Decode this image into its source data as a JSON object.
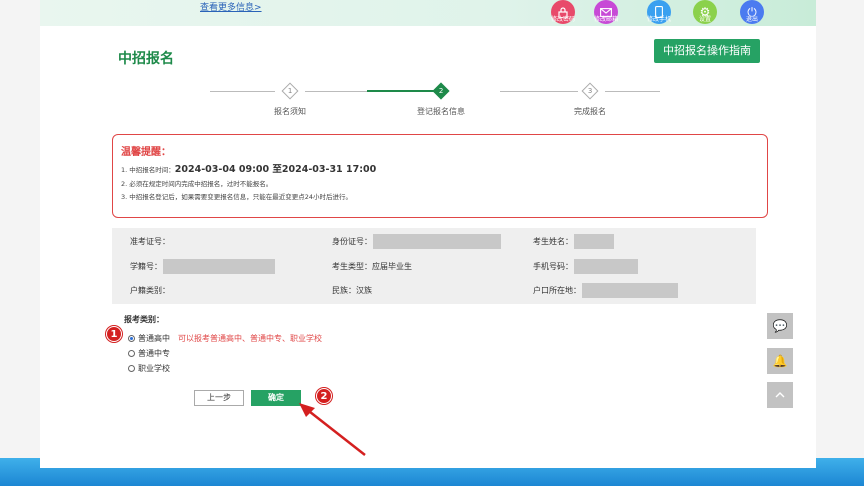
{
  "header": {
    "more_link": "查看更多信息>",
    "buttons": [
      {
        "label": "修改密码",
        "icon": "lock-icon",
        "color": "#e84a6a"
      },
      {
        "label": "修改邮箱",
        "icon": "mail-icon",
        "color": "#c74ad6"
      },
      {
        "label": "修改手机",
        "icon": "phone-icon",
        "color": "#3aa0f0"
      },
      {
        "label": "设置",
        "icon": "gear-icon",
        "color": "#8bd14c"
      },
      {
        "label": "退出",
        "icon": "power-icon",
        "color": "#4b7bf0"
      }
    ]
  },
  "page": {
    "title": "中招报名",
    "guide_button": "中招报名操作指南"
  },
  "steps": [
    {
      "num": "1",
      "label": "报名须知"
    },
    {
      "num": "2",
      "label": "登记报名信息"
    },
    {
      "num": "3",
      "label": "完成报名"
    }
  ],
  "notice": {
    "title": "温馨提醒：",
    "line1_prefix": "1. 中招报名时间：",
    "line1_time": "2024-03-04 09:00 至2024-03-31 17:00",
    "line2": "2. 必须在规定时间内完成中招报名，过时不能报名。",
    "line3": "3. 中招报名登记后，如果需要变更报名信息，只能在最近变更点24小时后进行。"
  },
  "info": {
    "exam_no": "准考证号：",
    "id_no": "身份证号：",
    "name": "考生姓名：",
    "student_no": "学籍号：",
    "type": "考生类型：应届毕业生",
    "phone": "手机号码：",
    "household": "户籍类别：",
    "ethnicity": "民族：汉族",
    "residence": "户口所在地："
  },
  "category": {
    "title": "报考类别：",
    "options": [
      "普通高中",
      "普通中专",
      "职业学校"
    ],
    "selected": "普通高中",
    "note": "可以报考普通高中、普通中专、职业学校"
  },
  "actions": {
    "prev": "上一步",
    "confirm": "确定"
  },
  "markers": [
    "1",
    "2"
  ]
}
